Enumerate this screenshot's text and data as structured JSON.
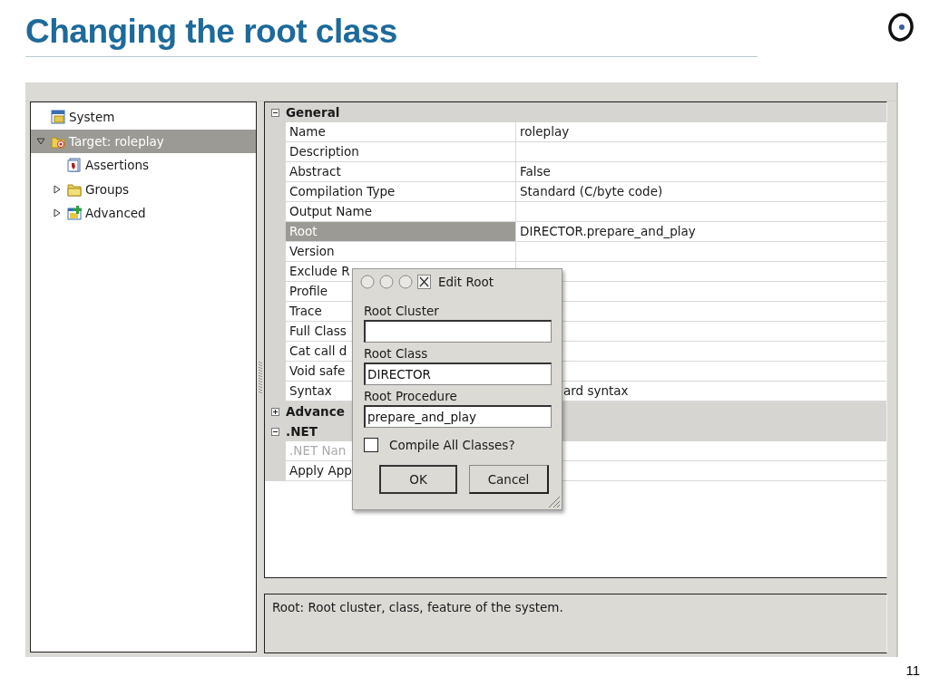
{
  "slide": {
    "title": "Changing the root class",
    "page_number": "11"
  },
  "tree": {
    "items": [
      {
        "label": "System",
        "kind": "system",
        "selected": false
      },
      {
        "label": "Target: roleplay",
        "kind": "target",
        "selected": true,
        "expanded": true,
        "children": [
          {
            "label": "Assertions",
            "kind": "document",
            "selected": false
          },
          {
            "label": "Groups",
            "kind": "folder",
            "selected": false,
            "expanded": false
          },
          {
            "label": "Advanced",
            "kind": "settings",
            "selected": false,
            "expanded": false
          }
        ]
      }
    ]
  },
  "properties": {
    "groups": [
      {
        "title": "General",
        "expanded": true,
        "rows": [
          {
            "name": "Name",
            "value": "roleplay",
            "selected": false,
            "disabled": false
          },
          {
            "name": "Description",
            "selected": false,
            "disabled": false
          },
          {
            "name": "Abstract",
            "value": "False",
            "selected": false,
            "disabled": false
          },
          {
            "name": "Compilation Type",
            "value": "Standard (C/byte code)",
            "selected": false,
            "disabled": false
          },
          {
            "name": "Output Name",
            "selected": false,
            "disabled": false
          },
          {
            "name": "Root",
            "value": "DIRECTOR.prepare_and_play",
            "selected": true,
            "disabled": false
          },
          {
            "name": "Version",
            "selected": false,
            "disabled": false
          },
          {
            "name": "Exclude R",
            "selected": false,
            "disabled": false
          },
          {
            "name": "Profile",
            "selected": false,
            "disabled": false
          },
          {
            "name": "Trace",
            "selected": false,
            "disabled": false
          },
          {
            "name": "Full Class",
            "selected": false,
            "disabled": false
          },
          {
            "name": "Cat call d",
            "selected": false,
            "disabled": false
          },
          {
            "name": "Void safe",
            "selected": false,
            "disabled": false
          },
          {
            "name": "Syntax",
            "value": "ard syntax",
            "selected": false,
            "disabled": false
          }
        ]
      },
      {
        "title": "Advance",
        "expanded": false
      },
      {
        "title": ".NET",
        "expanded": true,
        "rows": [
          {
            "name": ".NET Nan",
            "selected": false,
            "disabled": true
          },
          {
            "name": "Apply App",
            "selected": false,
            "disabled": false
          }
        ]
      }
    ]
  },
  "description": "Root: Root cluster, class, feature of the system.",
  "dialog": {
    "title": "Edit Root",
    "fields": [
      {
        "label": "Root Cluster"
      },
      {
        "label": "Root Class",
        "value": "DIRECTOR"
      },
      {
        "label": "Root Procedure",
        "value": "prepare_and_play"
      }
    ],
    "checkbox": {
      "label": "Compile All Classes?",
      "checked": false
    },
    "buttons": [
      "OK",
      "Cancel"
    ]
  }
}
